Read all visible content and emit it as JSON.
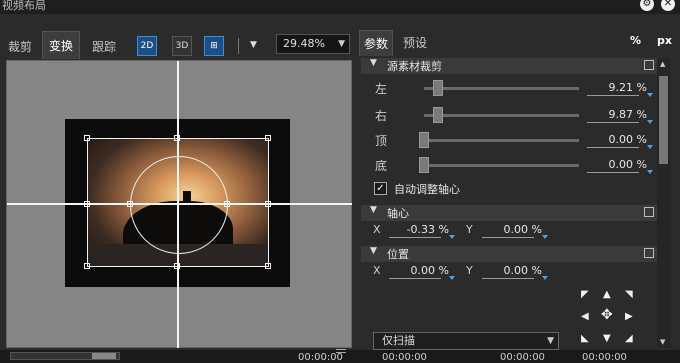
{
  "window": {
    "title": "视频布局"
  },
  "left": {
    "tabs": [
      "裁剪",
      "变换",
      "跟踪"
    ],
    "active_tab": "变换",
    "toolbar": {
      "zoom": "29.48%",
      "icons": [
        "2d-icon",
        "3d-icon",
        "grid-icon",
        "dropdown-icon"
      ],
      "label_2d": "2D",
      "label_3d": "3D"
    }
  },
  "right": {
    "tabs": [
      "参数",
      "预设"
    ],
    "active_tab": "参数",
    "units": [
      "%",
      "px"
    ],
    "sections": {
      "crop": {
        "title": "源素材裁剪",
        "rows": [
          {
            "label": "左",
            "value": "9.21",
            "unit": "%",
            "fraction": 0.092
          },
          {
            "label": "右",
            "value": "9.87",
            "unit": "%",
            "fraction": 0.099
          },
          {
            "label": "顶",
            "value": "0.00",
            "unit": "%",
            "fraction": 0.0
          },
          {
            "label": "底",
            "value": "0.00",
            "unit": "%",
            "fraction": 0.0
          }
        ],
        "auto_axis": {
          "checked": true,
          "label": "自动调整轴心"
        }
      },
      "axis": {
        "title": "轴心",
        "x": "-0.33",
        "y": "0.00",
        "unit": "%"
      },
      "position": {
        "title": "位置",
        "x": "0.00",
        "y": "0.00",
        "unit": "%"
      }
    },
    "dropdown": "仅扫描"
  },
  "status": {
    "times": [
      "00:00:00",
      "00:00:00",
      "00:00:00",
      "00:00:00"
    ]
  },
  "colors": {
    "accent": "#3a8ed6",
    "value_caret": "#4aa2e8",
    "panel": "#2b2b2b"
  }
}
